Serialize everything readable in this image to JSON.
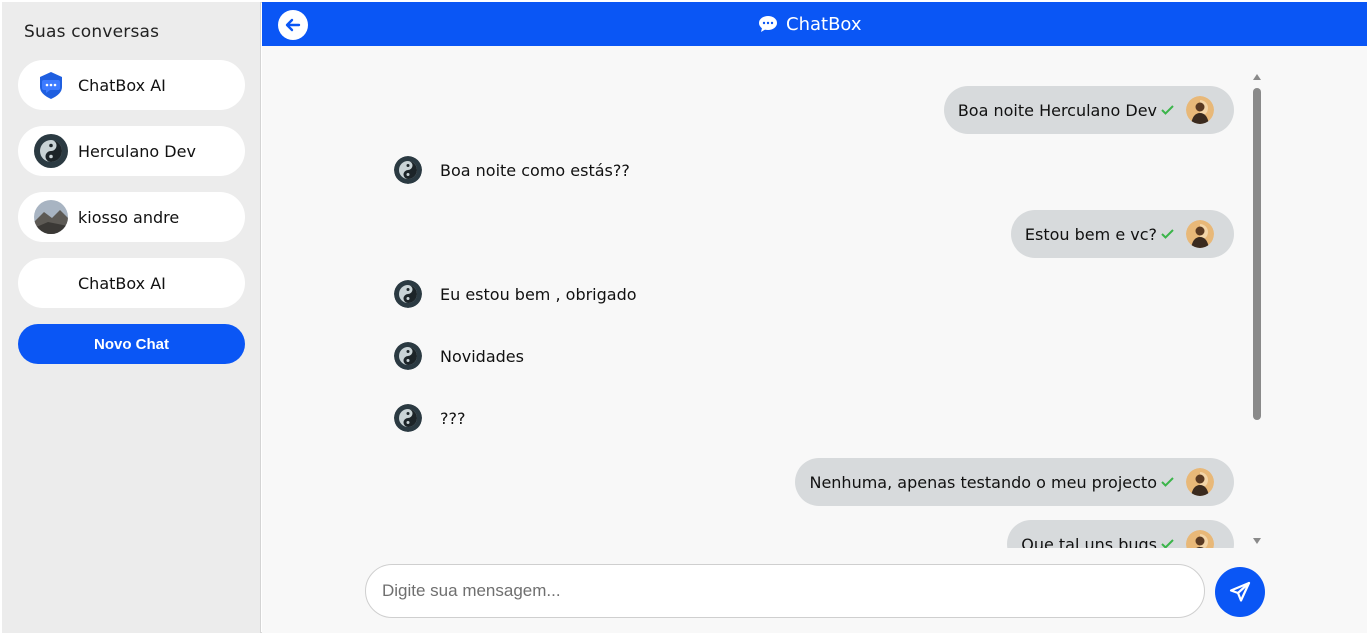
{
  "sidebar": {
    "title": "Suas conversas",
    "conversations": [
      {
        "name": "ChatBox AI",
        "icon": "chatbox-ai-logo"
      },
      {
        "name": "Herculano Dev",
        "icon": "yin-yang-avatar"
      },
      {
        "name": "kiosso andre",
        "icon": "landscape-avatar"
      },
      {
        "name": "ChatBox AI",
        "icon": ""
      }
    ],
    "new_chat_label": "Novo Chat"
  },
  "header": {
    "title": "ChatBox",
    "back_icon": "arrow-left-icon",
    "title_icon": "chat-bubble-icon"
  },
  "messages": [
    {
      "direction": "sent",
      "text": "Boa noite Herculano Dev",
      "status": "check"
    },
    {
      "direction": "received",
      "text": "Boa noite como estás??"
    },
    {
      "direction": "sent",
      "text": "Estou bem e vc?",
      "status": "check"
    },
    {
      "direction": "received",
      "text": "Eu estou bem , obrigado"
    },
    {
      "direction": "received",
      "text": "Novidades"
    },
    {
      "direction": "received",
      "text": "???"
    },
    {
      "direction": "sent",
      "text": "Nenhuma, apenas testando o meu projecto",
      "status": "check"
    },
    {
      "direction": "sent",
      "text": "Oue tal uns bugs",
      "status": "check"
    }
  ],
  "composer": {
    "placeholder": "Digite sua mensagem...",
    "value": "",
    "send_icon": "send-paper-plane-icon"
  },
  "colors": {
    "accent": "#0a56f5",
    "sidebar_bg": "#ececec",
    "sent_bubble": "#d7dadc",
    "check": "#3bb54a"
  }
}
